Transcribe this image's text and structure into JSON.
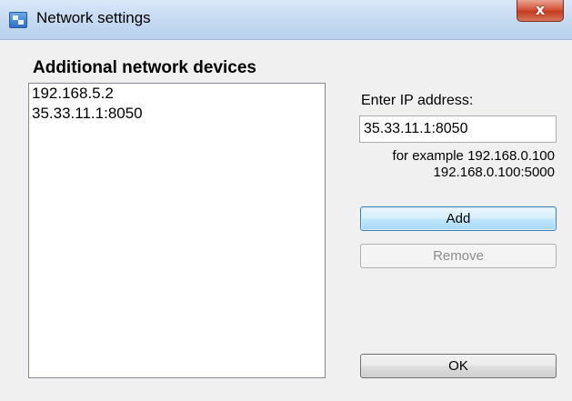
{
  "window": {
    "title": "Network settings",
    "close_label": "x",
    "icon": "network-settings-icon"
  },
  "devices": {
    "title": "Additional network devices",
    "items": [
      "192.168.5.2",
      "35.33.11.1:8050"
    ]
  },
  "ip_entry": {
    "label": "Enter IP address:",
    "value": "35.33.11.1:8050",
    "example_line1": "for example 192.168.0.100",
    "example_line2": "192.168.0.100:5000"
  },
  "buttons": {
    "add_label": "Add",
    "remove_label": "Remove",
    "ok_label": "OK"
  },
  "colors": {
    "accent": "#3c7fb1",
    "close": "#c43b1f",
    "disabled_text": "#8c8c8c"
  }
}
